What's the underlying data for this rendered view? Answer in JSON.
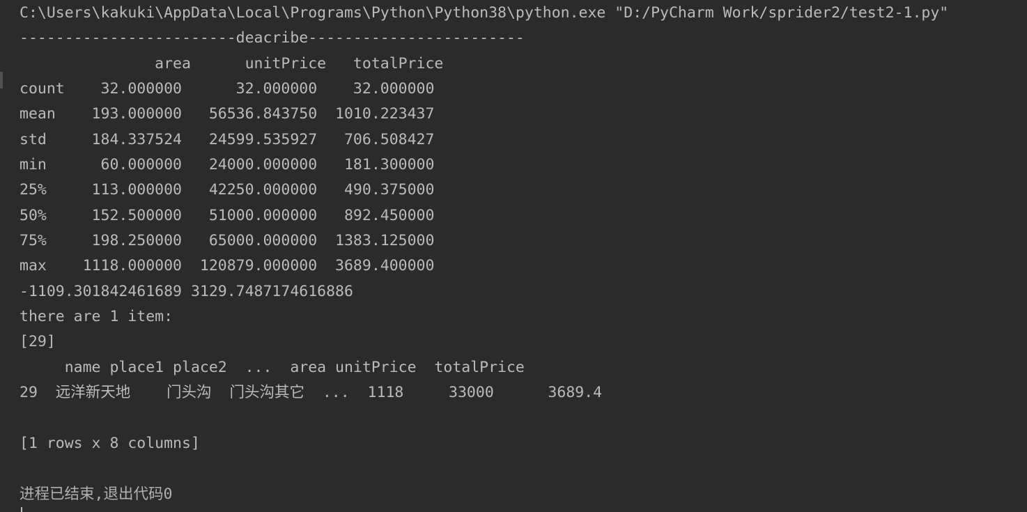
{
  "console": {
    "command_line": "C:\\Users\\kakuki\\AppData\\Local\\Programs\\Python\\Python38\\python.exe \"D:/PyCharm Work/sprider2/test2-1.py\"",
    "describe_header": "------------------------deacribe------------------------",
    "describe_table": {
      "header_line": "               area      unitPrice   totalPrice",
      "rows": [
        "count    32.000000      32.000000    32.000000",
        "mean    193.000000   56536.843750  1010.223437",
        "std     184.337524   24599.535927   706.508427",
        "min      60.000000   24000.000000   181.300000",
        "25%     113.000000   42250.000000   490.375000",
        "50%     152.500000   51000.000000   892.450000",
        "75%     198.250000   65000.000000  1383.125000",
        "max    1118.000000  120879.000000  3689.400000"
      ]
    },
    "bounds_line": "-1109.301842461689 3129.7487174616886",
    "item_count_line": "there are 1 item:",
    "index_list_line": "[29]",
    "result_header_line": "     name place1 place2  ...  area unitPrice  totalPrice",
    "result_row_line": "29  远洋新天地    门头沟  门头沟其它  ...  1118     33000      3689.4",
    "blank_line": "",
    "shape_line": "[1 rows x 8 columns]",
    "exit_line": "进程已结束,退出代码0"
  }
}
